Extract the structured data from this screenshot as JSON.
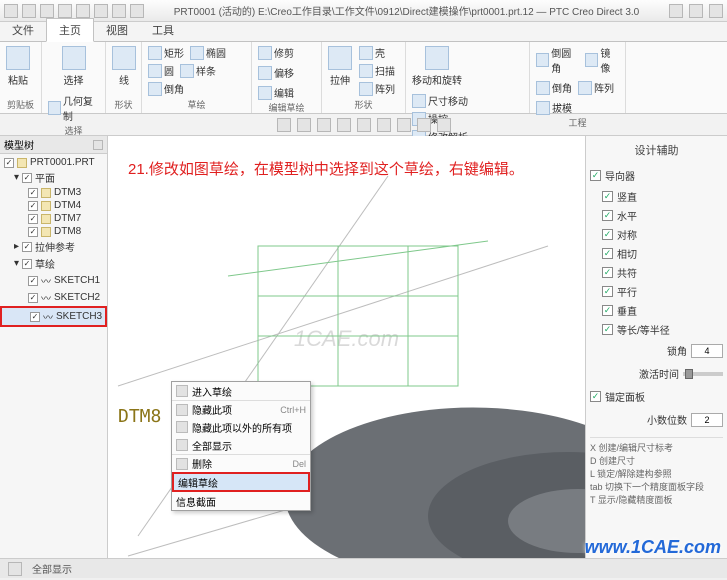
{
  "titlebar": {
    "title": "PRT0001 (活动的) E:\\Creo工作目录\\工作文件\\0912\\Direct建模操作\\prt0001.prt.12 — PTC Creo Direct 3.0"
  },
  "tabs": {
    "file": "文件",
    "home": "主页",
    "view": "视图",
    "tool": "工具"
  },
  "ribbon": {
    "g_clip": "剪贴板",
    "g_sel": "选择",
    "g_shape": "形状",
    "g_sketch": "草绘",
    "g_editsk": "编辑草绘",
    "g_form": "形状",
    "g_edit": "编辑",
    "g_eng": "工程",
    "paste": "粘贴",
    "select": "选择",
    "copy": "复制",
    "delete": "删除",
    "geomsel": "几何复制",
    "rect": "矩形",
    "circ": "椭圆",
    "arc": "圆",
    "line": "线",
    "spline": "样条",
    "chamfer": "倒角",
    "trim": "修剪",
    "offset": "偏移",
    "edit": "编辑",
    "sweep": "扫描",
    "extrude": "拉伸",
    "shell": "壳",
    "pattern": "阵列",
    "move": "尺寸移动",
    "align": "移动和旋转",
    "drag": "操控",
    "copyg": "修改解析",
    "arr": "阵列",
    "hole": "倒圆角",
    "cham": "倒角",
    "rib": "拔模",
    "mir": "镜像",
    "sketch_assist": "设计辅助"
  },
  "tree": {
    "header": "模型树",
    "root": "PRT0001.PRT",
    "planes": "平面",
    "dtm3": "DTM3",
    "dtm4": "DTM4",
    "dtm7": "DTM7",
    "dtm8": "DTM8",
    "extrude": "拉伸参考",
    "sketch_grp": "草绘",
    "sk1": "SKETCH1",
    "sk2": "SKETCH2",
    "sk3": "SKETCH3"
  },
  "ctx": {
    "enter": "进入草绘",
    "hide": "隐藏此项",
    "hideother": "隐藏此项以外的所有项",
    "showall": "全部显示",
    "delete": "删除",
    "del_key": "Del",
    "ctrlh": "Ctrl+H",
    "editdef": "编辑草绘",
    "info": "信息截面"
  },
  "assist": {
    "title": "设计辅助",
    "guide": "导向器",
    "vert": "竖直",
    "horz": "水平",
    "sym": "对称",
    "tan": "相切",
    "coinc": "共符",
    "para": "平行",
    "perp": "垂直",
    "eqrad": "等长/等半径",
    "precAngle_l": "锁角",
    "precAngle_v": "4",
    "animTime_l": "激活时间",
    "grid": "锚定面板",
    "decimals_l": "小数位数",
    "decimals_v": "2",
    "hints": "X 创建/编辑尺寸标考\nD 创建尺寸\nL 锁定/解除建构参照\ntab 切换下一个精度面板字段\nT 显示/隐藏精度面板"
  },
  "canvas": {
    "annotation": "21.修改如图草绘，在模型树中选择到这个草绘，右键编辑。",
    "dtm": "DTM8",
    "watermark": "1CAE.com"
  },
  "status": {
    "ready": "全部显示"
  },
  "brand": "www.1CAE.com"
}
